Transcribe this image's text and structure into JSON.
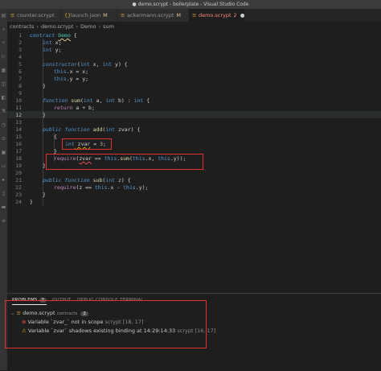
{
  "window": {
    "title": "● demo.scrypt - boilerplate - Visual Studio Code"
  },
  "tabs": [
    {
      "label": "counter.scrypt",
      "mark": ""
    },
    {
      "label": "launch.json",
      "mark": "M"
    },
    {
      "label": "ackermann.scrypt",
      "mark": "M"
    },
    {
      "label": "demo.scrypt",
      "mark": "2",
      "active": true
    }
  ],
  "breadcrumb": {
    "folder": "contracts",
    "file": "demo.scrypt",
    "symbol1": "Demo",
    "symbol2": "sum"
  },
  "editor": {
    "line_numbers": [
      "1",
      "2",
      "3",
      "4",
      "5",
      "6",
      "7",
      "8",
      "9",
      "10",
      "11",
      "12",
      "13",
      "14",
      "15",
      "16",
      "17",
      "18",
      "19",
      "20",
      "21",
      "22",
      "23",
      "24"
    ],
    "code": {
      "l1a": "contract ",
      "l1b": "Demo",
      "l1c": " {",
      "l2a": "int",
      "l2b": " x;",
      "l3a": "int",
      "l3b": " y;",
      "l5a": "constructor",
      "l5b": "(",
      "l5c": "int",
      "l5d": " x, ",
      "l5e": "int",
      "l5f": " y) {",
      "l6a": "this",
      "l6b": ".x = x;",
      "l7a": "this",
      "l7b": ".y = y;",
      "l8": "}",
      "l10a": "function ",
      "l10b": "sum",
      "l10c": "(",
      "l10d": "int",
      "l10e": " a, ",
      "l10f": "int",
      "l10g": " b) : ",
      "l10h": "int",
      "l10i": " {",
      "l11a": "return",
      "l11b": " a + b;",
      "l12": "}",
      "l14a": "public function ",
      "l14b": "add",
      "l14c": "(",
      "l14d": "int",
      "l14e": " zvar) {",
      "l15": "{",
      "l16a": "int",
      "l16b": " zvar",
      "l16c": " = ",
      "l16d": "3",
      "l16e": ";",
      "l17": "}",
      "l18a": "require",
      "l18b": "(",
      "l18c": "zvar",
      "l18d": " == ",
      "l18e": "this",
      "l18f": ".",
      "l18g": "sum",
      "l18h": "(",
      "l18i": "this",
      "l18j": ".x, ",
      "l18k": "this",
      "l18l": ".y));",
      "l19": "}",
      "l21a": "public function ",
      "l21b": "sub",
      "l21c": "(",
      "l21d": "int",
      "l21e": " z) {",
      "l22a": "require",
      "l22b": "(z == ",
      "l22c": "this",
      "l22d": ".x - ",
      "l22e": "this",
      "l22f": ".y);",
      "l23": "}",
      "l24": "}"
    }
  },
  "panel": {
    "tabs": {
      "problems": "PROBLEMS",
      "problems_count": "2",
      "output": "OUTPUT",
      "debug": "DEBUG CONSOLE",
      "terminal": "TERMINAL"
    },
    "file": {
      "name": "demo.scrypt",
      "folder": "contracts",
      "count": "2"
    },
    "problems": [
      {
        "severity": "error",
        "message": "Variable `zvar_` not in scope",
        "source": "scrypt",
        "location": "[18, 17]"
      },
      {
        "severity": "warning",
        "message": "Variable `zvar` shadows existing binding at 14:29:14:33",
        "source": "scrypt",
        "location": "[16, 17]"
      }
    ]
  },
  "colors": {
    "error": "#f14c4c",
    "warning": "#cca700",
    "annotation": "#e0332f"
  }
}
